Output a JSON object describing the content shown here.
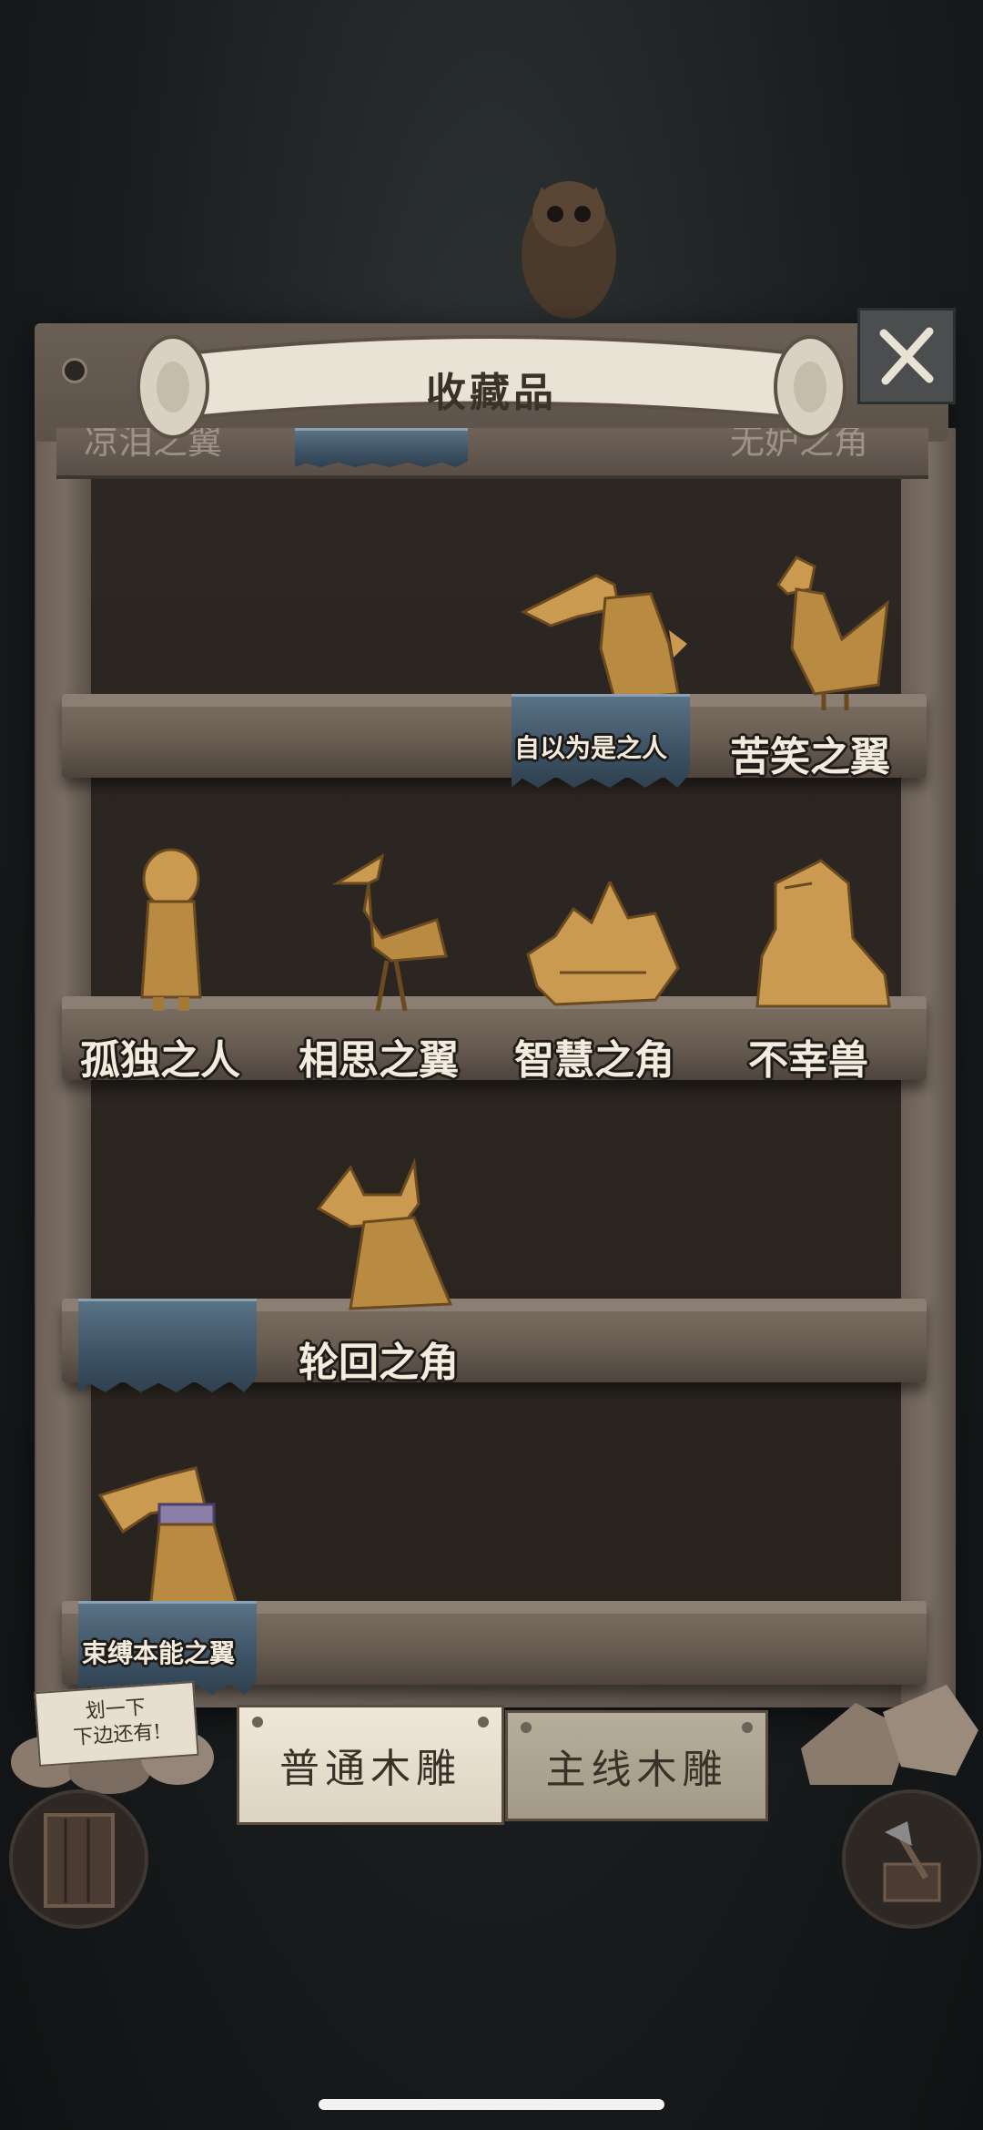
{
  "header": {
    "title": "收藏品"
  },
  "partial_top_labels": {
    "left": "凉泪之翼",
    "right": "无妒之角"
  },
  "shelves": [
    {
      "items": [
        {
          "label": "自以为是之人",
          "icon": "crocodile-man-carving"
        },
        {
          "label": "苦笑之翼",
          "icon": "rooster-carving"
        }
      ]
    },
    {
      "items": [
        {
          "label": "孤独之人",
          "icon": "girl-carving"
        },
        {
          "label": "相思之翼",
          "icon": "crane-carving"
        },
        {
          "label": "智慧之角",
          "icon": "tortoise-carving"
        },
        {
          "label": "不幸兽",
          "icon": "capybara-carving"
        }
      ]
    },
    {
      "items": [
        {
          "label": "轮回之角",
          "icon": "bull-carving"
        }
      ]
    },
    {
      "items": [
        {
          "label": "束缚本能之翼",
          "icon": "bound-bird-carving"
        }
      ]
    }
  ],
  "tabs": {
    "normal": "普通木雕",
    "main": "主线木雕"
  },
  "hint": {
    "line1": "划一下",
    "line2": "下边还有!"
  },
  "colors": {
    "wood": "#6c6157",
    "cloth": "#3c5264",
    "carving": "#c99a4f",
    "label": "#f3ecde"
  }
}
